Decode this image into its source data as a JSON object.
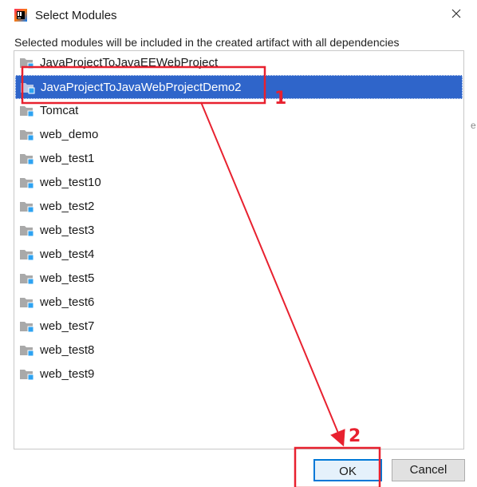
{
  "window": {
    "title": "Select Modules",
    "close_icon": "close-icon",
    "app_icon": "intellij-idea-icon"
  },
  "description": "Selected modules will be included in the created artifact with all dependencies",
  "modules": [
    {
      "label": "JavaProjectToJavaEEWebProject",
      "selected": false
    },
    {
      "label": "JavaProjectToJavaWebProjectDemo2",
      "selected": true
    },
    {
      "label": "Tomcat",
      "selected": false
    },
    {
      "label": "web_demo",
      "selected": false
    },
    {
      "label": "web_test1",
      "selected": false
    },
    {
      "label": "web_test10",
      "selected": false
    },
    {
      "label": "web_test2",
      "selected": false
    },
    {
      "label": "web_test3",
      "selected": false
    },
    {
      "label": "web_test4",
      "selected": false
    },
    {
      "label": "web_test5",
      "selected": false
    },
    {
      "label": "web_test6",
      "selected": false
    },
    {
      "label": "web_test7",
      "selected": false
    },
    {
      "label": "web_test8",
      "selected": false
    },
    {
      "label": "web_test9",
      "selected": false
    }
  ],
  "buttons": {
    "ok_label": "OK",
    "cancel_label": "Cancel"
  },
  "annotations": {
    "step1_label": "1",
    "step2_label": "2",
    "color": "#e8212f"
  },
  "colors": {
    "selection": "#2f65ca",
    "ok_border": "#0078d7",
    "folder": "#a9a9a9",
    "module_badge": "#2ea3f2"
  }
}
